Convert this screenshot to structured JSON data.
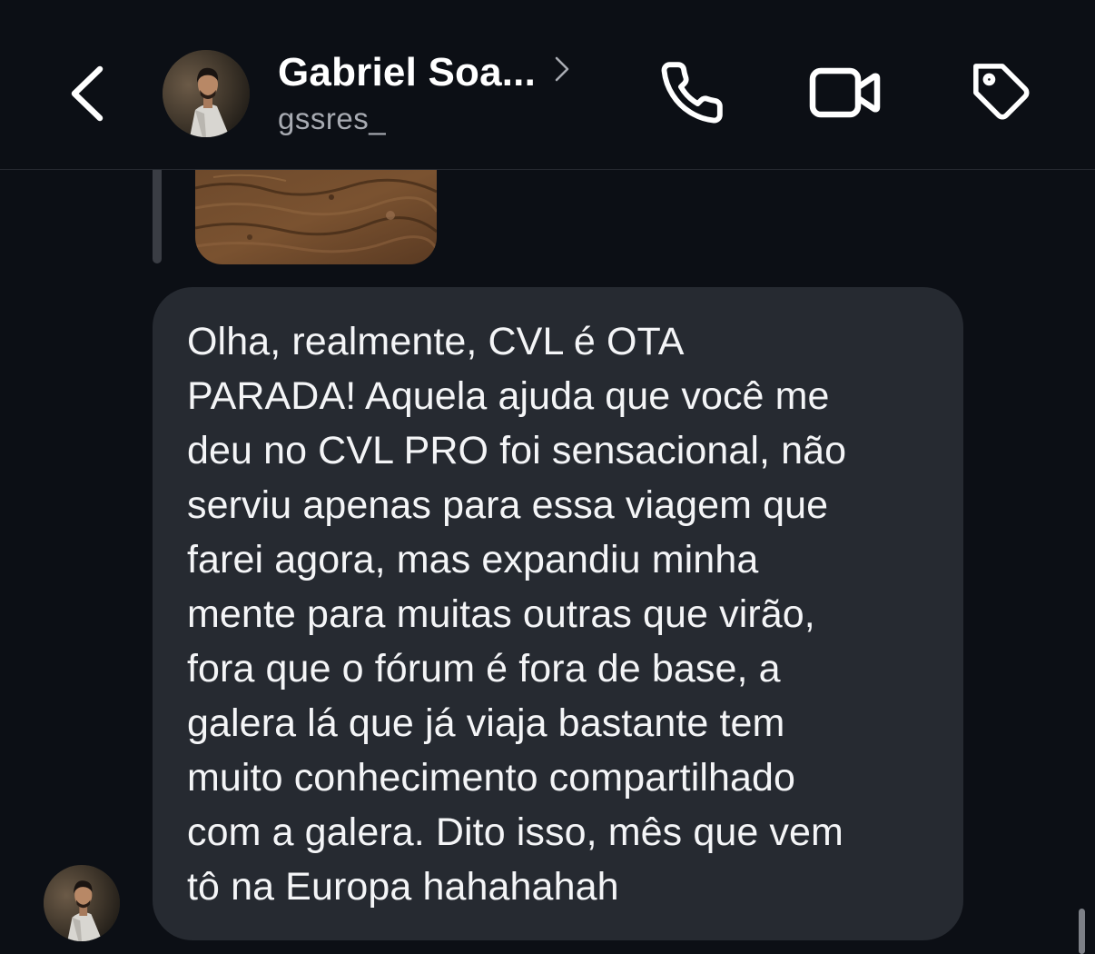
{
  "header": {
    "back_icon": "chevron-left-icon",
    "contact_name": "Gabriel Soa...",
    "contact_username": "gssres_",
    "name_chevron_icon": "chevron-right-icon",
    "actions": [
      {
        "name": "voice-call",
        "icon": "phone-icon"
      },
      {
        "name": "video-call",
        "icon": "video-camera-icon"
      },
      {
        "name": "label",
        "icon": "tag-icon"
      }
    ]
  },
  "messages": [
    {
      "type": "media",
      "description": "",
      "replied": true
    },
    {
      "type": "text",
      "from": "contact",
      "text": "Olha, realmente, CVL é OTA\nPARADA! Aquela ajuda que você me\ndeu no CVL PRO foi sensacional, não\nserviu apenas para essa viagem que\nfarei agora, mas expandiu minha\nmente para muitas outras que virão,\nfora que o fórum é fora de base, a\ngalera lá que já viaja bastante tem\nmuito conhecimento compartilhado\ncom a galera. Dito isso, mês que vem\ntô na Europa hahahahah"
    }
  ],
  "colors": {
    "background": "#0c0f15",
    "bubble": "#262a31",
    "text": "#f4f5f7",
    "secondary_text": "#a8abb2"
  }
}
